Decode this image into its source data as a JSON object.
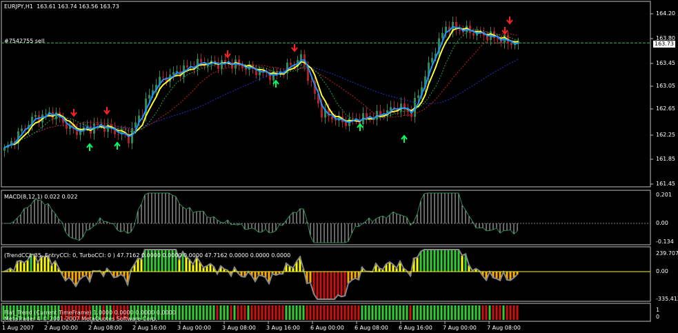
{
  "header": {
    "symbol": "EURJPY,H1",
    "ohlc": "163.61 163.74 163.56 163.73",
    "order_label": "#7542755 sell"
  },
  "main_axis": {
    "labels": [
      "164.20",
      "163.80",
      "163.45",
      "163.05",
      "162.65",
      "162.25",
      "161.85",
      "161.45"
    ],
    "current_price": "163.73"
  },
  "macd": {
    "title": "MACD(8,12,1) 0.022 0.022",
    "labels": [
      "0.201",
      "0.00",
      "-0.134"
    ]
  },
  "cci": {
    "title": "(TrendCCI: 35, EntryCCI: 0, TurboCCI: 0 )  47.7162 0.0000 0.0000 0.0000 47.7162 0.0000 0.0000 0.0000",
    "labels": [
      "239.707",
      "0.00",
      "-335.412"
    ]
  },
  "flat": {
    "title": "Flat_Trend (Current TimeFrame)  1.0000 0.0000 0.0000 0.0000",
    "copyright": "MetaTrader 4 © 2001-2007 MetaQuotes Software Corp.",
    "labels": [
      "1",
      "0"
    ]
  },
  "time_axis": [
    "1 Aug 2007",
    "2 Aug 00:00",
    "2 Aug 08:00",
    "2 Aug 16:00",
    "3 Aug 00:00",
    "3 Aug 08:00",
    "3 Aug 16:00",
    "6 Aug 00:00",
    "6 Aug 08:00",
    "6 Aug 16:00",
    "7 Aug 00:00",
    "7 Aug 08:00"
  ],
  "colors": {
    "bull": "#2e8b57",
    "bear": "#b22222",
    "fast_ma": "#1e90ff",
    "slow_ma": "#ffff33",
    "arrow_down": "#ff2020",
    "arrow_up": "#00ff66",
    "macd_line": "#2e8b57",
    "cci_green": "#33cc33",
    "cci_orange": "#ffaa00",
    "cci_red": "#cc1111",
    "cci_yellow": "#ffff00",
    "axis": "#c0c0c0"
  }
}
